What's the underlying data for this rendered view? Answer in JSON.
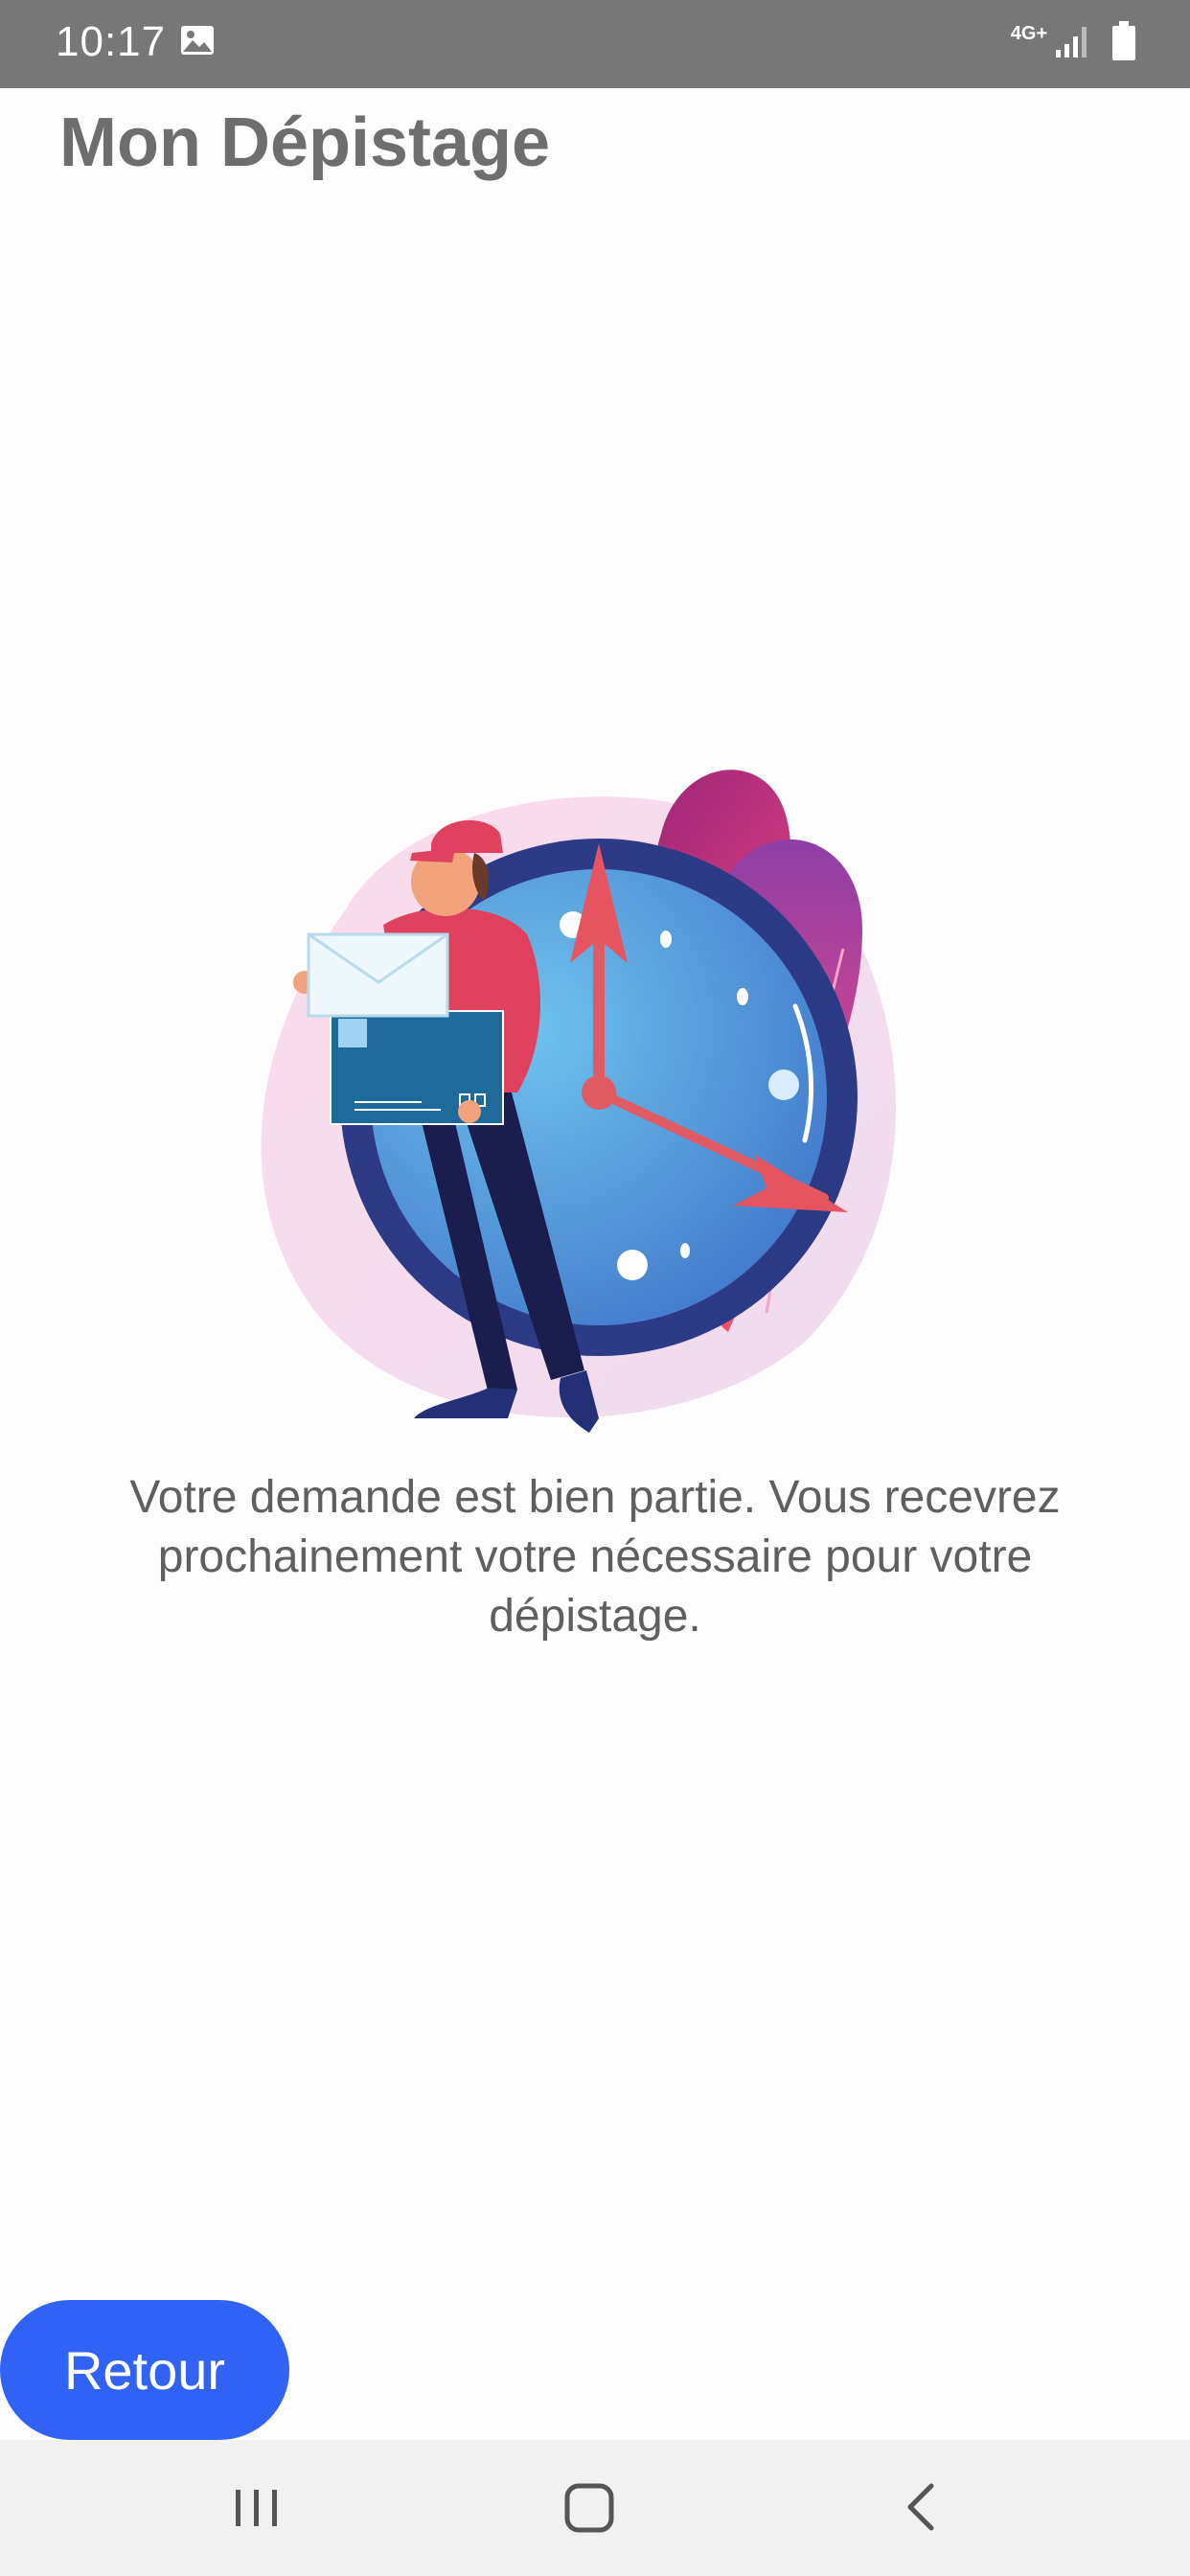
{
  "status_bar": {
    "time": "10:17",
    "network_label": "4G+",
    "icons": [
      "gallery-icon",
      "network-arrows-icon",
      "signal-icon",
      "battery-icon"
    ],
    "background_color": "#777777"
  },
  "header": {
    "title": "Mon Dépistage"
  },
  "main": {
    "illustration": "delivery-person-with-package-and-clock",
    "message": "Votre demande est bien partie. Vous recevrez prochainement votre nécessaire pour votre dépistage."
  },
  "actions": {
    "back_label": "Retour",
    "back_color": "#2f62f5"
  },
  "nav_bar": {
    "items": [
      "recents-icon",
      "home-icon",
      "back-icon"
    ]
  }
}
